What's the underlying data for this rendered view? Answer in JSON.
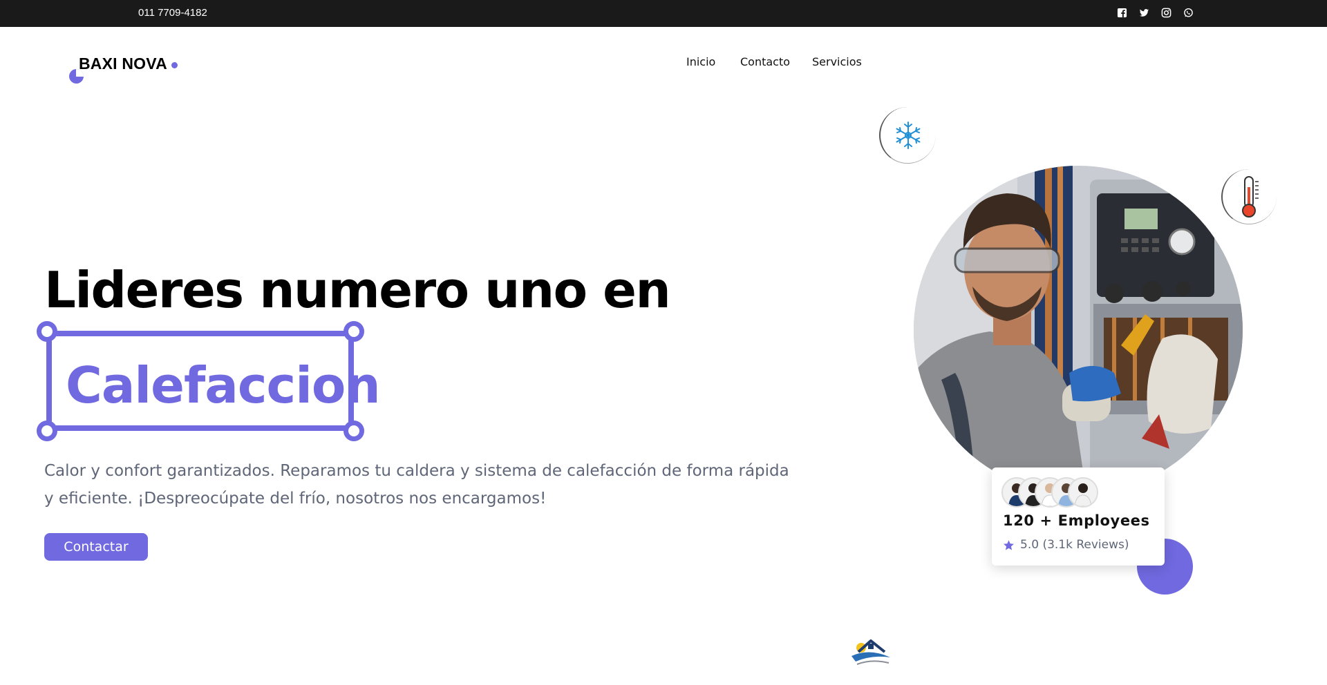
{
  "topbar": {
    "phone": "011 7709-4182",
    "social_icons": [
      "facebook-icon",
      "twitter-icon",
      "instagram-icon",
      "whatsapp-icon"
    ]
  },
  "brand": {
    "name": "BAXI NOVA",
    "accent_color": "#7069e0"
  },
  "nav": {
    "items": [
      "Inicio",
      "Contacto",
      "Servicios"
    ]
  },
  "hero": {
    "title": "Lideres numero uno en",
    "highlight": "Calefaccion",
    "description": "Calor y confort garantizados. Reparamos tu caldera y sistema de calefacción de forma rápida y eficiente. ¡Despreocúpate del frío, nosotros nos encargamos!",
    "cta_label": "Contactar"
  },
  "stats_card": {
    "employees": "120 + Employees",
    "rating": "5.0 (3.1k Reviews)"
  },
  "decor_icons": [
    "snowflake-icon",
    "thermometer-icon",
    "house-logo-icon"
  ]
}
